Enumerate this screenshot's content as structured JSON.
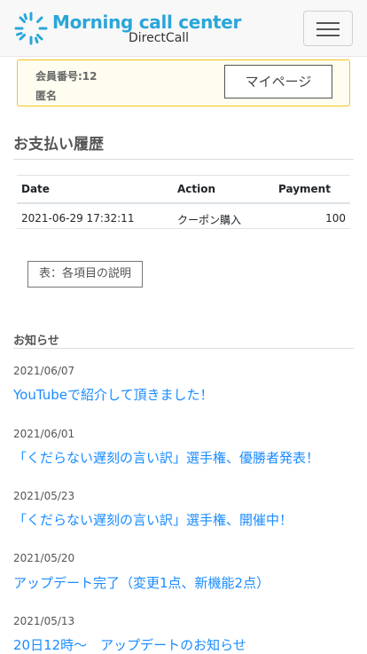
{
  "brand": {
    "name_line1": "Morning call center",
    "name_line2": "DirectCall",
    "accent": "#2aa6d9"
  },
  "nav": {
    "menu_icon": "hamburger-icon"
  },
  "member": {
    "id_label": "会員番号:12",
    "name_label": "匿名",
    "mypage_button": "マイページ"
  },
  "payments": {
    "title": "お支払い履歴",
    "columns": [
      "Date",
      "Action",
      "Payment"
    ],
    "rows": [
      [
        "2021-06-29 17:32:11",
        "クーポン購入",
        "100"
      ]
    ],
    "description_button": "表：各項目の説明"
  },
  "news": {
    "title": "お知らせ",
    "link_color": "#1a8cff",
    "items": [
      {
        "date": "2021/06/07",
        "text": "YouTubeで紹介して頂きました！"
      },
      {
        "date": "2021/06/01",
        "text": "「くだらない遅刻の言い訳」選手権、優勝者発表！"
      },
      {
        "date": "2021/05/23",
        "text": "「くだらない遅刻の言い訳」選手権、開催中！"
      },
      {
        "date": "2021/05/20",
        "text": "アップデート完了（変更1点、新機能2点）"
      },
      {
        "date": "2021/05/13",
        "text": "20日12時〜　アップデートのお知らせ"
      }
    ]
  }
}
